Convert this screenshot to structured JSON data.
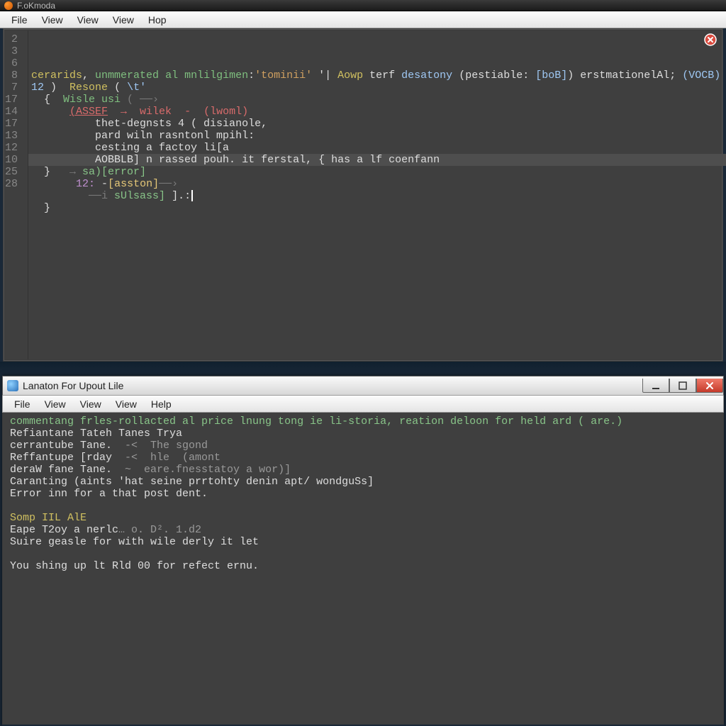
{
  "top_titlebar": {
    "title": "F.oKmoda"
  },
  "upper_menubar": {
    "items": [
      "File",
      "View",
      "View",
      "View",
      "Hop"
    ]
  },
  "editor": {
    "gutter": [
      "2",
      "3",
      "6",
      "8",
      "7",
      "17",
      "14",
      "17",
      "13",
      "12",
      "10",
      "25",
      "28"
    ],
    "highlight_line_index": 10,
    "lines": [
      [
        {
          "cls": "tok-y",
          "t": "cerarids"
        },
        {
          "cls": "tok-w",
          "t": ", "
        },
        {
          "cls": "tok-c",
          "t": "unmmerated al mnlilgimen"
        },
        {
          "cls": "tok-w",
          "t": ":"
        },
        {
          "cls": "tok-o",
          "t": "'tominii'"
        },
        {
          "cls": "tok-w",
          "t": " '| "
        },
        {
          "cls": "tok-y",
          "t": "Aowp"
        },
        {
          "cls": "tok-w",
          "t": " terf "
        },
        {
          "cls": "tok-b",
          "t": "desatony"
        },
        {
          "cls": "tok-w",
          "t": " (pestiable: "
        },
        {
          "cls": "tok-b",
          "t": "[boB]"
        },
        {
          "cls": "tok-w",
          "t": ") erstmationelAl; "
        },
        {
          "cls": "tok-b",
          "t": "(VOCB)"
        }
      ],
      [
        {
          "cls": "tok-b",
          "t": "12"
        },
        {
          "cls": "tok-w",
          "t": " )  "
        },
        {
          "cls": "tok-y",
          "t": "Resone"
        },
        {
          "cls": "tok-w",
          "t": " ( "
        },
        {
          "cls": "tok-b",
          "t": "\\t'"
        }
      ],
      [
        {
          "cls": "tok-w",
          "t": "  {  "
        },
        {
          "cls": "tok-c",
          "t": "Wisle usi"
        },
        {
          "cls": "tok-g",
          "t": " ( ──›"
        }
      ],
      [
        {
          "cls": "tok-w",
          "t": "      "
        },
        {
          "cls": "tok-r2",
          "t": "(ASSEF"
        },
        {
          "cls": "tok-r",
          "t": "  →  wilek  -  (lwoml)"
        }
      ],
      [
        {
          "cls": "tok-w",
          "t": "          thet-degnsts 4 ( disianole,"
        }
      ],
      [
        {
          "cls": "tok-w",
          "t": "          pard wiln rasntonl mpihl:"
        }
      ],
      [
        {
          "cls": "tok-w",
          "t": "          cesting a factoy li[a"
        }
      ],
      [
        {
          "cls": "tok-w",
          "t": "          AOBBLB] n rassed pouh. it ferstal, { has a lf coenfann"
        }
      ],
      [
        {
          "cls": "tok-w",
          "t": "  }   "
        },
        {
          "cls": "tok-g",
          "t": "→ "
        },
        {
          "cls": "tok-gr",
          "t": "sa)[error]"
        }
      ],
      [
        {
          "cls": "tok-w",
          "t": "       "
        },
        {
          "cls": "tok-kw",
          "t": "12:"
        },
        {
          "cls": "tok-w",
          "t": " -"
        },
        {
          "cls": "tok-br",
          "t": "[asston]"
        },
        {
          "cls": "tok-g",
          "t": "──›"
        }
      ],
      [
        {
          "cls": "tok-w",
          "t": "         "
        },
        {
          "cls": "tok-g",
          "t": "──i "
        },
        {
          "cls": "tok-gr",
          "t": "sUlsass]"
        },
        {
          "cls": "tok-w",
          "t": " ].:"
        }
      ],
      [
        {
          "cls": "tok-w",
          "t": "  }"
        }
      ],
      [
        {
          "cls": "tok-w",
          "t": ""
        }
      ]
    ]
  },
  "lower_titlebar": {
    "title": "Lanaton For Upout Lile"
  },
  "lower_menubar": {
    "items": [
      "File",
      "View",
      "View",
      "View",
      "Help"
    ]
  },
  "console": {
    "lines": [
      [
        {
          "cls": "c-g",
          "t": "commentang frles-rollacted al price lnung tong ie li-storia, reation deloon for held ard ( are.)"
        }
      ],
      [
        {
          "cls": "c-w",
          "t": "Refiantane Tateh Tanes Trya"
        }
      ],
      [
        {
          "cls": "c-w",
          "t": "cerrantube Tane."
        },
        {
          "cls": "c-gr",
          "t": "  -<  The sgond"
        }
      ],
      [
        {
          "cls": "c-w",
          "t": "Reffantupe [rday"
        },
        {
          "cls": "c-gr",
          "t": "  -<  hle  (amont"
        }
      ],
      [
        {
          "cls": "c-w",
          "t": "deraW fane Tane."
        },
        {
          "cls": "c-gr",
          "t": "  ~  eare.fnesstatoy a wor)]"
        }
      ],
      [
        {
          "cls": "c-w",
          "t": "Caranting (aints 'hat seine prrtohty denin apt/ wondguSs]"
        }
      ],
      [
        {
          "cls": "c-w",
          "t": "Error inn for a that post dent."
        }
      ],
      [
        {
          "cls": "c-w",
          "t": ""
        }
      ],
      [
        {
          "cls": "c-y",
          "t": "Somp IIL AlE"
        }
      ],
      [
        {
          "cls": "c-w",
          "t": "Eape T2oy a nerlc"
        },
        {
          "cls": "c-gr",
          "t": "… o. D². 1.d2"
        }
      ],
      [
        {
          "cls": "c-w",
          "t": "Suire geasle for with wile derly it let"
        }
      ],
      [
        {
          "cls": "c-w",
          "t": ""
        }
      ],
      [
        {
          "cls": "c-w",
          "t": "You shing up lt Rld 00 for refect ernu."
        }
      ]
    ]
  }
}
